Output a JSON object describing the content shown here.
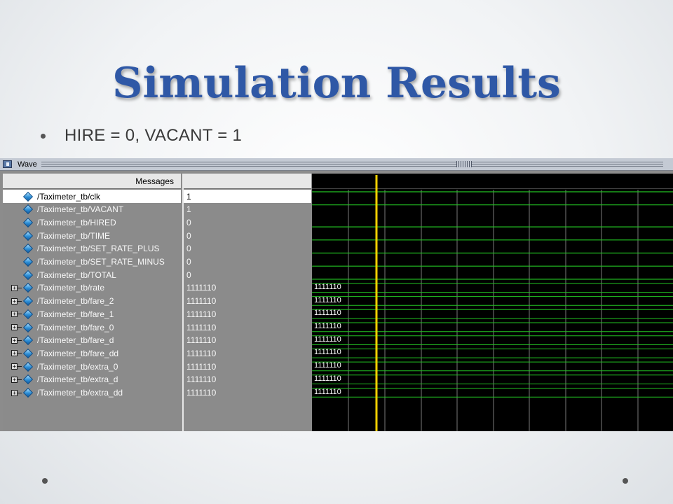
{
  "slide": {
    "title": "Simulation Results",
    "bullet": "HIRE = 0, VACANT = 1"
  },
  "wave_window": {
    "title": "Wave",
    "messages_header": "Messages",
    "cursor_color": "#f5d000",
    "signal_color": "#22c422",
    "signals": [
      {
        "name": "/Taximeter_tb/clk",
        "value": "1",
        "bus": false,
        "wave_label": "",
        "selected": true
      },
      {
        "name": "/Taximeter_tb/VACANT",
        "value": "1",
        "bus": false,
        "wave_label": "",
        "selected": false
      },
      {
        "name": "/Taximeter_tb/HIRED",
        "value": "0",
        "bus": false,
        "wave_label": "",
        "selected": false
      },
      {
        "name": "/Taximeter_tb/TIME",
        "value": "0",
        "bus": false,
        "wave_label": "",
        "selected": false
      },
      {
        "name": "/Taximeter_tb/SET_RATE_PLUS",
        "value": "0",
        "bus": false,
        "wave_label": "",
        "selected": false
      },
      {
        "name": "/Taximeter_tb/SET_RATE_MINUS",
        "value": "0",
        "bus": false,
        "wave_label": "",
        "selected": false
      },
      {
        "name": "/Taximeter_tb/TOTAL",
        "value": "0",
        "bus": false,
        "wave_label": "",
        "selected": false
      },
      {
        "name": "/Taximeter_tb/rate",
        "value": "1111110",
        "bus": true,
        "wave_label": "1111110",
        "selected": false
      },
      {
        "name": "/Taximeter_tb/fare_2",
        "value": "1111110",
        "bus": true,
        "wave_label": "1111110",
        "selected": false
      },
      {
        "name": "/Taximeter_tb/fare_1",
        "value": "1111110",
        "bus": true,
        "wave_label": "1111110",
        "selected": false
      },
      {
        "name": "/Taximeter_tb/fare_0",
        "value": "1111110",
        "bus": true,
        "wave_label": "1111110",
        "selected": false
      },
      {
        "name": "/Taximeter_tb/fare_d",
        "value": "1111110",
        "bus": true,
        "wave_label": "1111110",
        "selected": false
      },
      {
        "name": "/Taximeter_tb/fare_dd",
        "value": "1111110",
        "bus": true,
        "wave_label": "1111110",
        "selected": false
      },
      {
        "name": "/Taximeter_tb/extra_0",
        "value": "1111110",
        "bus": true,
        "wave_label": "1111110",
        "selected": false
      },
      {
        "name": "/Taximeter_tb/extra_d",
        "value": "1111110",
        "bus": true,
        "wave_label": "1111110",
        "selected": false
      },
      {
        "name": "/Taximeter_tb/extra_dd",
        "value": "1111110",
        "bus": true,
        "wave_label": "1111110",
        "selected": false
      }
    ]
  }
}
